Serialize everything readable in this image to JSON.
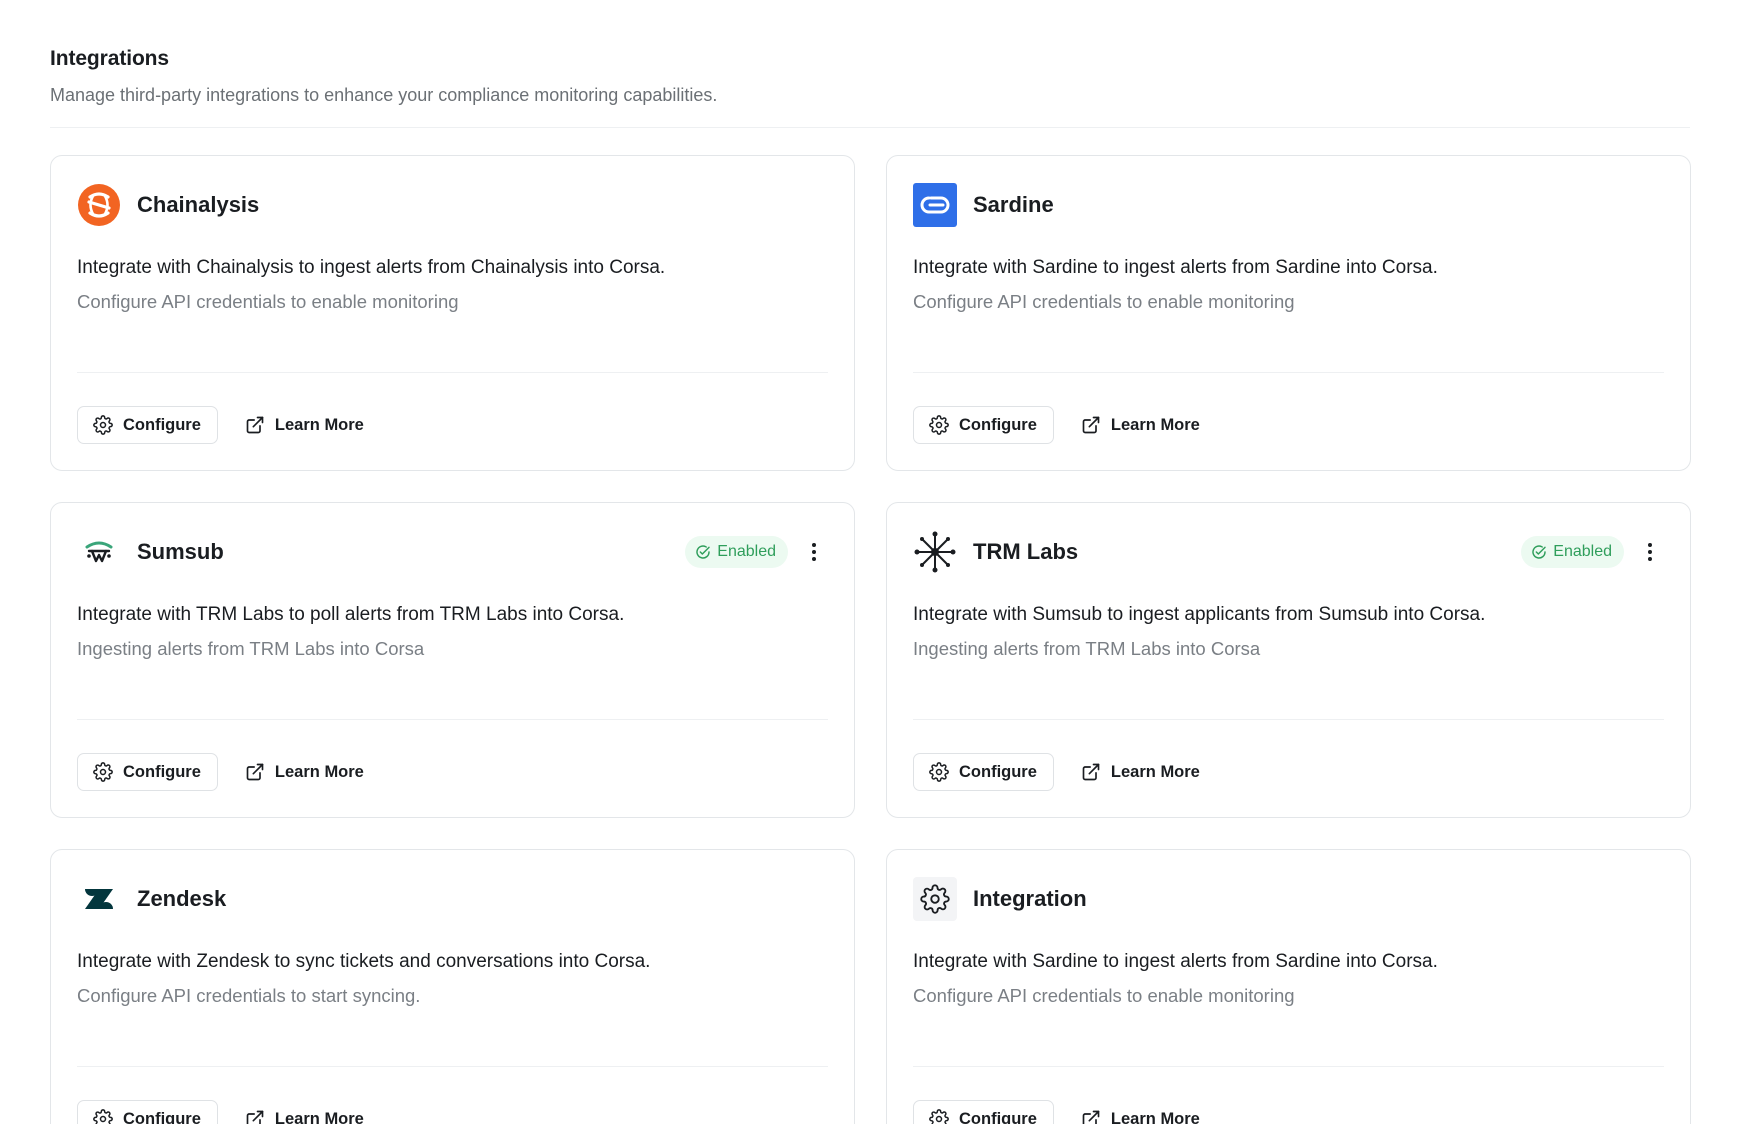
{
  "page": {
    "title": "Integrations",
    "description": "Manage third-party integrations to enhance your compliance monitoring capabilities."
  },
  "cards": [
    {
      "name": "Chainalysis",
      "logo": "chainalysis-logo",
      "description": "Integrate with Chainalysis to ingest alerts from Chainalysis into Corsa.",
      "status_text": "Configure API credentials to enable monitoring",
      "enabled": false,
      "configure_label": "Configure",
      "learn_more_label": "Learn More"
    },
    {
      "name": "Sardine",
      "logo": "sardine-logo",
      "description": "Integrate with Sardine to ingest alerts from Sardine into Corsa.",
      "status_text": "Configure API credentials to enable monitoring",
      "enabled": false,
      "configure_label": "Configure",
      "learn_more_label": "Learn More"
    },
    {
      "name": "Sumsub",
      "logo": "sumsub-logo",
      "description": "Integrate with TRM Labs to poll alerts from TRM Labs into Corsa.",
      "status_text": "Ingesting alerts from TRM Labs into Corsa",
      "enabled": true,
      "badge_label": "Enabled",
      "configure_label": "Configure",
      "learn_more_label": "Learn More"
    },
    {
      "name": "TRM Labs",
      "logo": "trm-labs-logo",
      "description": "Integrate with Sumsub to ingest applicants from Sumsub into Corsa.",
      "status_text": "Ingesting alerts from TRM Labs into Corsa",
      "enabled": true,
      "badge_label": "Enabled",
      "configure_label": "Configure",
      "learn_more_label": "Learn More"
    },
    {
      "name": "Zendesk",
      "logo": "zendesk-logo",
      "description": "Integrate with Zendesk to sync tickets and conversations into Corsa.",
      "status_text": "Configure API credentials to start syncing.",
      "enabled": false,
      "configure_label": "Configure",
      "learn_more_label": "Learn More"
    },
    {
      "name": "Integration",
      "logo": "gear-icon",
      "description": "Integrate with Sardine to ingest alerts from Sardine into Corsa.",
      "status_text": "Configure API credentials to enable monitoring",
      "enabled": false,
      "configure_label": "Configure",
      "learn_more_label": "Learn More"
    }
  ],
  "colors": {
    "chainalysis": "#f26422",
    "sardine": "#2f6fe8",
    "enabled_badge_bg": "#ecfaf1",
    "enabled_badge_text": "#2f9e5b",
    "border": "#e3e6e9"
  }
}
